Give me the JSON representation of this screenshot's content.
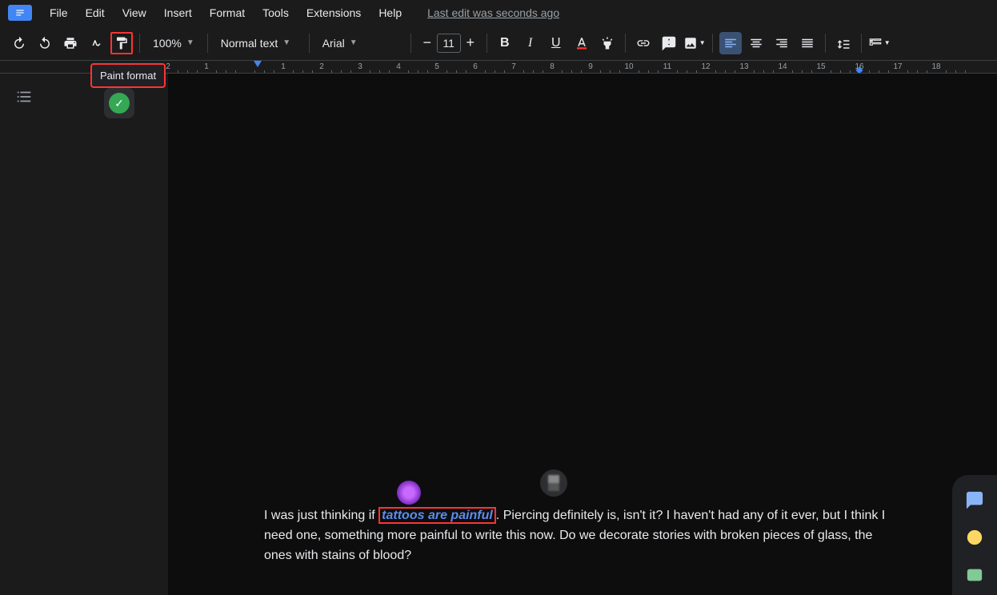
{
  "menubar": {
    "items": [
      "File",
      "Edit",
      "View",
      "Insert",
      "Format",
      "Tools",
      "Extensions",
      "Help"
    ],
    "last_edit": "Last edit was seconds ago"
  },
  "toolbar": {
    "tooltip": "Paint format",
    "zoom": "100%",
    "style": "Normal text",
    "font": "Arial",
    "font_size": "11"
  },
  "ruler": {
    "marks": [
      2,
      1,
      "",
      1,
      2,
      3,
      4,
      5,
      6,
      7,
      8,
      9,
      10,
      11,
      12,
      13,
      14,
      15,
      16,
      17,
      18
    ]
  },
  "document": {
    "text_before": "I was just thinking if ",
    "styled_text": "tattoos are painful",
    "text_after": ". Piercing definitely is, isn't it? I haven't had any of it ever, but I think I need one, something more painful to write this now. Do we decorate stories with broken pieces of glass, the ones with stains of blood?"
  }
}
